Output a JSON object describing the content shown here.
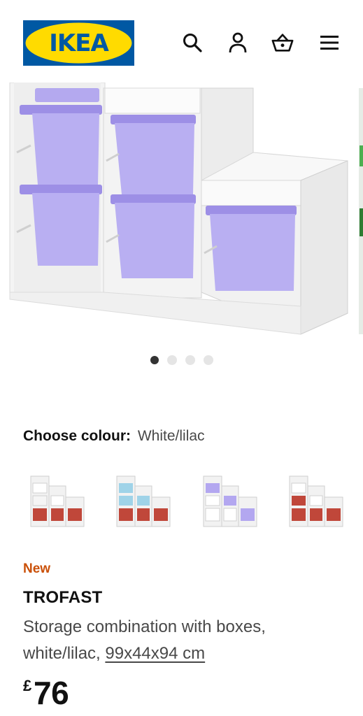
{
  "header": {
    "logo_text": "IKEA",
    "icons": [
      "search-icon",
      "user-icon",
      "basket-icon",
      "menu-icon"
    ]
  },
  "gallery": {
    "slide_count": 4,
    "active_slide": 1
  },
  "colour": {
    "label": "Choose colour:",
    "value": "White/lilac",
    "options": [
      "white-red",
      "white-lightblue-red",
      "white-lilac",
      "white-red-alt"
    ],
    "selected": "white-lilac"
  },
  "product": {
    "badge": "New",
    "name": "TROFAST",
    "description": "Storage combination with boxes, white/lilac,",
    "dimensions": "99x44x94 cm",
    "currency": "£",
    "price": "76"
  },
  "colors": {
    "ikea_blue": "#0058a3",
    "ikea_yellow": "#ffdb00",
    "new_badge": "#ca5008",
    "lilac": "#b3a7f0",
    "red_box": "#c04a3a",
    "light_blue_box": "#9fd3e8"
  }
}
